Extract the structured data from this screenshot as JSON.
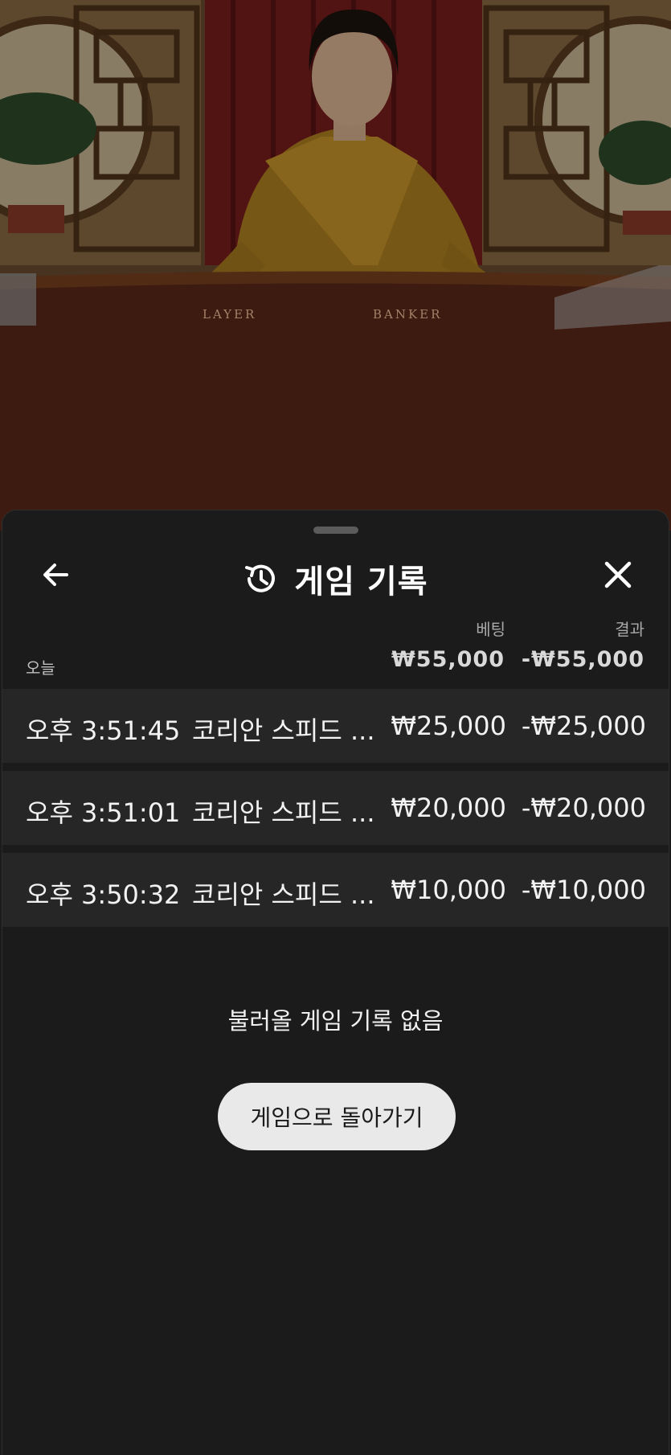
{
  "video": {
    "table_labels": {
      "player": "LAYER",
      "banker": "BANKER"
    }
  },
  "sheet": {
    "header": {
      "back_icon": "arrow-left-icon",
      "history_icon": "history-clock-icon",
      "title": "게임 기록",
      "close_icon": "close-x-icon"
    },
    "columns": {
      "bet": "베팅",
      "result": "결과"
    },
    "summary": {
      "label": "오늘",
      "bet": "₩55,000",
      "result": "-₩55,000"
    },
    "rows": [
      {
        "time": "오후 3:51:45",
        "game": "코리안 스피드 ...",
        "bet": "₩25,000",
        "result": "-₩25,000"
      },
      {
        "time": "오후 3:51:01",
        "game": "코리안 스피드 ...",
        "bet": "₩20,000",
        "result": "-₩20,000"
      },
      {
        "time": "오후 3:50:32",
        "game": "코리안 스피드 ...",
        "bet": "₩10,000",
        "result": "-₩10,000"
      }
    ],
    "empty_message": "불러올 게임 기록 없음",
    "return_button": "게임으로 돌아가기"
  },
  "colors": {
    "sheet_bg": "#1b1b1b",
    "row_bg": "#262626",
    "button_bg": "#e9e9e9",
    "table_felt": "#5a2818"
  }
}
